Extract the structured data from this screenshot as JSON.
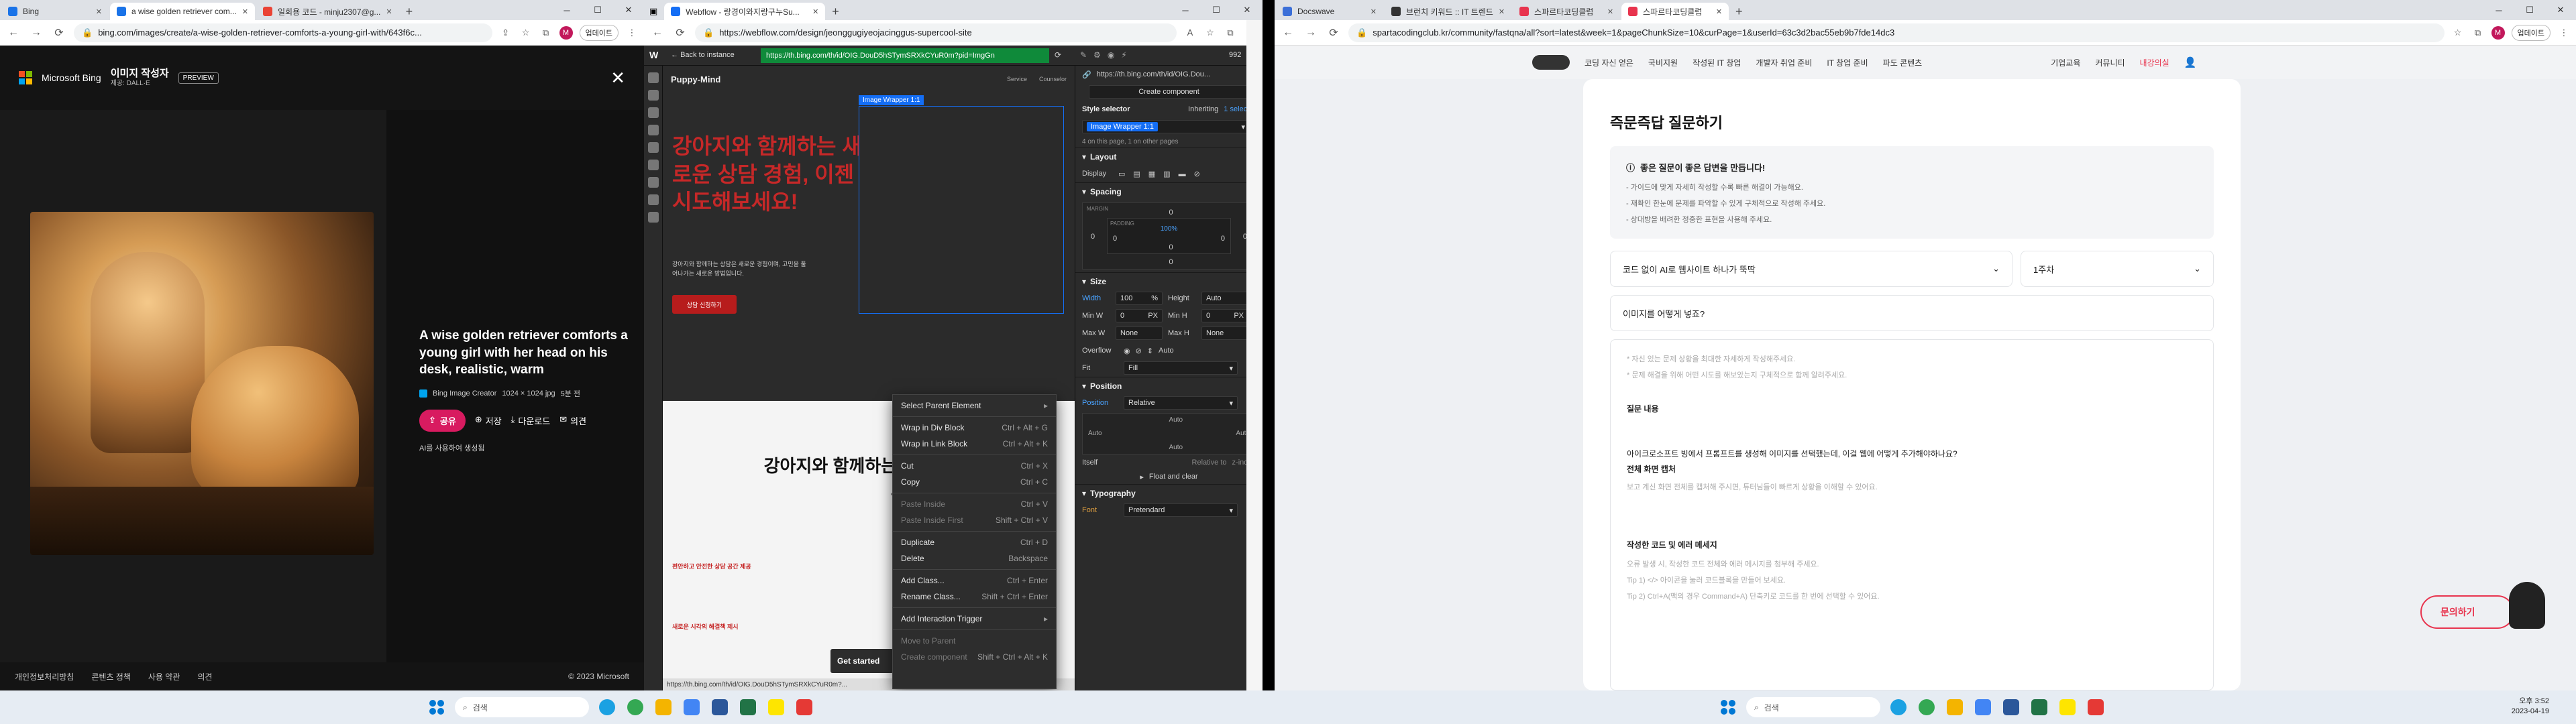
{
  "bing": {
    "tabs": [
      "Bing",
      "a wise golden retriever com...",
      "일회용 코드 - minju2307@g..."
    ],
    "url": "bing.com/images/create/a-wise-golden-retriever-comforts-a-young-girl-with/643f6c...",
    "profile_pill": "업데이트",
    "brand": "Microsoft Bing",
    "app_title": "이미지 작성자",
    "app_sub": "제공: DALL·E",
    "preview": "PREVIEW",
    "caption": "A wise golden retriever comforts a young girl with her head on his desk, realistic, warm",
    "meta_creator": "Bing Image Creator",
    "meta_size": "1024 × 1024 jpg",
    "meta_time": "5분 전",
    "share": "공유",
    "save": "저장",
    "download": "다운로드",
    "feedback": "의견",
    "report": "AI를 사용하여 생성됨",
    "footer": [
      "개인정보처리방침",
      "콘텐츠 정책",
      "사용 약관",
      "의견"
    ],
    "copyright": "© 2023 Microsoft"
  },
  "webflow": {
    "tabs": [
      "Webflow - 랑경이와지랑구누Su..."
    ],
    "url": "https://webflow.com/design/jeonggugiyeojacinggus-supercool-site",
    "back": "Back to instance",
    "img_url": "https://th.bing.com/th/id/OIG.DouD5hSTymSRXkCYuR0m?pid=ImgGn",
    "site_brand": "Puppy-Mind",
    "site_nav": [
      "Service",
      "Counselor"
    ],
    "selected_label": "Image Wrapper 1:1",
    "hero_title": "강아지와 함께하는 새로운 상담 경험, 이젠 시도해보세요!",
    "hero_desc": "강아지와 함께하는 상담은 새로운 경험이며, 고민을 풀어나가는 새로운 방법입니다.",
    "hero_btn": "상담 신청하기",
    "section2_title": "강아지와 함께하는 상담, 무엇이 좋을까요?",
    "feature1_title": "편안하고 안전한 상담 공간 제공",
    "feature2_title": "새로운 시각의 해결책 제시",
    "get_started": "Get started",
    "status_url": "https://th.bing.com/th/id/OIG.DouD5hSTymSRXkCYuR0m?...",
    "panel_width_display": "992",
    "panel_url": "https://th.bing.com/th/id/OIG.Dou...",
    "create_component": "Create component",
    "style_selector": "Style selector",
    "inheriting": "Inheriting",
    "inherit_count": "1 selector",
    "class_chip": "Image Wrapper 1:1",
    "on_page": "4 on this page, 1 on other pages",
    "layout": "Layout",
    "display": "Display",
    "spacing": "Spacing",
    "margin": "MARGIN",
    "padding": "PADDING",
    "pad_val": "100%",
    "zero": "0",
    "size": "Size",
    "width": "Width",
    "width_val": "100",
    "width_unit": "%",
    "height": "Height",
    "height_val": "Auto",
    "minw": "Min W",
    "minh": "Min H",
    "maxw": "Max W",
    "maxh": "Max H",
    "none": "None",
    "px": "PX",
    "overflow": "Overflow",
    "auto": "Auto",
    "fit": "Fit",
    "fill": "Fill",
    "position": "Position",
    "position_label": "Position",
    "position_val": "Relative",
    "itself": "Itself",
    "relative_to": "Relative to",
    "zindex": "z-index",
    "float_clear": "Float and clear",
    "typography": "Typography",
    "font": "Font",
    "font_val": "Pretendard",
    "ctx_items": [
      {
        "label": "Select Parent Element",
        "key": "▸",
        "dis": false
      },
      {
        "label": "Wrap in Div Block",
        "key": "Ctrl + Alt + G",
        "dis": false
      },
      {
        "label": "Wrap in Link Block",
        "key": "Ctrl + Alt + K",
        "dis": false
      },
      {
        "label": "Cut",
        "key": "Ctrl + X",
        "dis": false
      },
      {
        "label": "Copy",
        "key": "Ctrl + C",
        "dis": false
      },
      {
        "label": "Paste Inside",
        "key": "Ctrl + V",
        "dis": true
      },
      {
        "label": "Paste Inside First",
        "key": "Shift + Ctrl + V",
        "dis": true
      },
      {
        "label": "Duplicate",
        "key": "Ctrl + D",
        "dis": false
      },
      {
        "label": "Delete",
        "key": "Backspace",
        "dis": false
      },
      {
        "label": "Add Class...",
        "key": "Ctrl + Enter",
        "dis": false
      },
      {
        "label": "Rename Class...",
        "key": "Shift + Ctrl + Enter",
        "dis": false
      },
      {
        "label": "Add Interaction Trigger",
        "key": "▸",
        "dis": false
      },
      {
        "label": "Move to Parent",
        "key": "",
        "dis": true
      },
      {
        "label": "Create component",
        "key": "Shift + Ctrl + Alt + K",
        "dis": true
      }
    ]
  },
  "sparta": {
    "tabs": [
      "Docswave",
      "브런치 키워드 :: IT 트렌드",
      "스파르타코딩클럽",
      "스파르타코딩클럽"
    ],
    "url": "spartacodingclub.kr/community/fastqna/all?sort=latest&week=1&pageChunkSize=10&curPage=1&userId=63c3d2bac55eb9b7fde14dc3",
    "nav": [
      "코딩 자신 얻은",
      "국비지원",
      "작성된 IT 창업",
      "개발자 취업 준비",
      "IT 창업 준비",
      "파도 콘텐츠"
    ],
    "nav_right": [
      "기업교육",
      "커뮤니티",
      "내강의실"
    ],
    "title": "즉문즉답 질문하기",
    "notice_head": "좋은 질문이 좋은 답변을 만듭니다!",
    "notice_items": [
      "- 가이드에 맞게 자세히 작성할 수록 빠른 해결이 가능해요.",
      "- 재확인 한눈에 문제를 파악할 수 있게 구체적으로 작성해 주세요.",
      "- 상대방을 배려한 정중한 표현을 사용해 주세요."
    ],
    "course_select": "코드 없이 AI로 웹사이트 하나가 뚝딱",
    "week_select": "1주차",
    "question_title": "이미지를 어떻게 넣죠?",
    "hint_items": [
      "* 자신 있는 문제 상황을 최대한 자세하게 작성해주세요.",
      "* 문제 해결을 위해 어떤 시도를 해보았는지 구체적으로 함께 알려주세요."
    ],
    "section_question": "질문 내용",
    "question_body": "아이크로소프트 빙에서 프롬프트를 생성해 이미지를 선택했는데, 이걸 웹에 어떻게 추가해야하나요?",
    "section_screen": "전체 화면 캡처",
    "screen_hint": "보고 계신 화면 전체를 캡처해 주시면, 튜터님들이 빠르게 상황을 이해할 수 있어요.",
    "section_code": "작성한 코드 및 에러 메세지",
    "code_hints": [
      "오류 발생 시, 작성한 코드 전체와 에러 메시지를 첨부해 주세요.",
      "Tip 1) </> 아이콘을 눌러 코드블록을 만들어 보세요.",
      "Tip 2) Ctrl+A(맥의 경우 Command+A) 단축키로 코드를 한 번에 선택할 수 있어요."
    ],
    "ask_button": "문의하기"
  },
  "taskbar": {
    "search_left": "검색",
    "search_right": "검색",
    "time": "오후 3:52",
    "date": "2023-04-19"
  },
  "colors": {
    "bing_pink": "#d81b60",
    "webflow_blue": "#146ef5",
    "hero_red": "#b71c1c",
    "sparta_red": "#e8344e"
  }
}
